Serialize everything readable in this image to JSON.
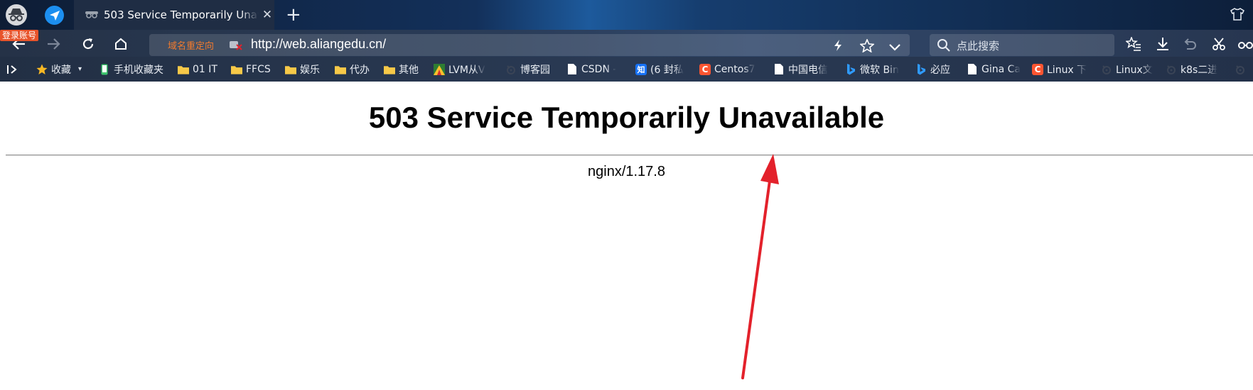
{
  "browser": {
    "login_badge": "登录账号",
    "tab": {
      "title": "503 Service Temporarily Unavailable",
      "close_glyph": "✕"
    },
    "new_tab_glyph": "+",
    "address_bar": {
      "redirect_label": "域名重定向",
      "url": "http://web.aliangedu.cn/"
    },
    "search": {
      "placeholder": "点此搜索"
    },
    "bookmarks": [
      {
        "label": "收藏",
        "icon": "star-icon"
      },
      {
        "label": "手机收藏夹",
        "icon": "phone-icon"
      },
      {
        "label": "01 IT",
        "icon": "folder-icon"
      },
      {
        "label": "FFCS",
        "icon": "folder-icon"
      },
      {
        "label": "娱乐",
        "icon": "folder-icon"
      },
      {
        "label": "代办",
        "icon": "folder-icon"
      },
      {
        "label": "其他",
        "icon": "folder-icon"
      },
      {
        "label": "LVM从V",
        "icon": "site-icon"
      },
      {
        "label": "博客园",
        "icon": "cnblogs-icon"
      },
      {
        "label": "CSDN -",
        "icon": "page-icon"
      },
      {
        "label": "(6 封私",
        "icon": "zhihu-icon"
      },
      {
        "label": "Centos7",
        "icon": "csdn-icon"
      },
      {
        "label": "中国电信",
        "icon": "page-icon"
      },
      {
        "label": "微软 Bin",
        "icon": "bing-icon"
      },
      {
        "label": "必应",
        "icon": "bing-icon"
      },
      {
        "label": "Gina Ca",
        "icon": "page-icon"
      },
      {
        "label": "Linux 下",
        "icon": "csdn-icon"
      },
      {
        "label": "Linux文",
        "icon": "cnblogs-icon"
      },
      {
        "label": "k8s二进",
        "icon": "cnblogs-icon"
      }
    ],
    "icon_texts": {
      "zhihu": "知",
      "csdn": "C"
    },
    "accent_colors": {
      "redirect": "#f07a2e",
      "badge": "#e8542b",
      "arrow": "#e3212b",
      "folder": "#f7c948"
    }
  },
  "page": {
    "title": "503 Service Temporarily Unavailable",
    "server_signature": "nginx/1.17.8"
  }
}
